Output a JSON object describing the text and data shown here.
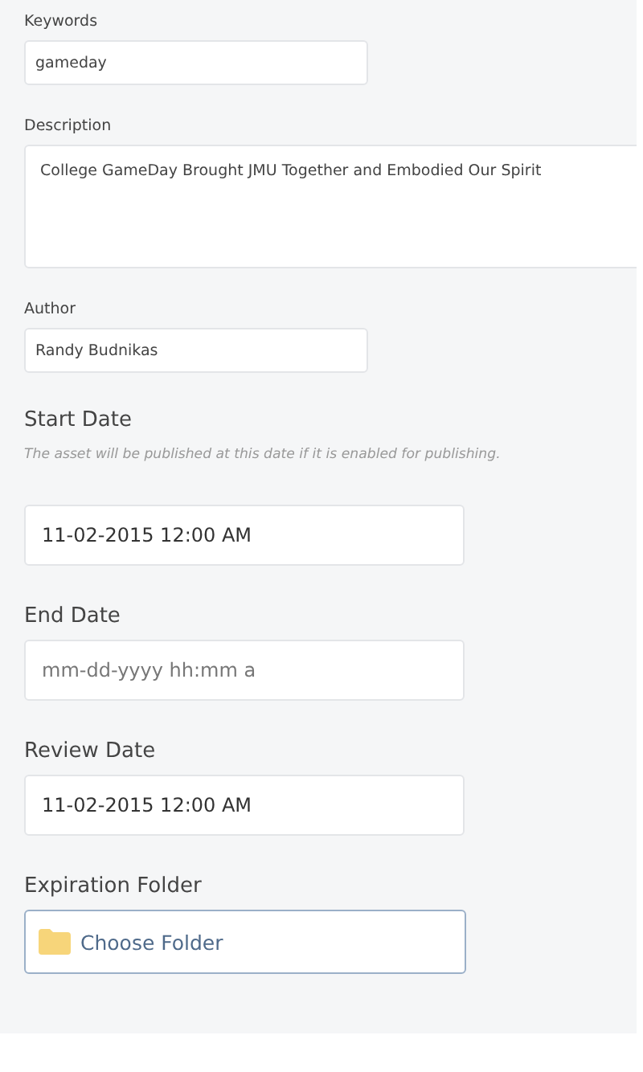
{
  "fields": [
    {
      "kind": "small-input",
      "label": "Keywords",
      "value": "gameday"
    },
    {
      "kind": "textarea",
      "label": "Description",
      "value": "College GameDay Brought JMU Together and Embodied Our Spirit"
    },
    {
      "kind": "small-input",
      "label": "Author",
      "value": "Randy Budnikas"
    },
    {
      "kind": "date-input",
      "label": "Start Date",
      "hint": "The asset will be published at this date if it is enabled for publishing.",
      "value": "11-02-2015 12:00 AM"
    },
    {
      "kind": "date-input",
      "label": "End Date",
      "placeholder": "mm-dd-yyyy hh:mm a"
    },
    {
      "kind": "date-input",
      "label": "Review Date",
      "value": "11-02-2015 12:00 AM"
    },
    {
      "kind": "folder-picker",
      "label": "Expiration Folder",
      "button": "Choose Folder"
    }
  ]
}
